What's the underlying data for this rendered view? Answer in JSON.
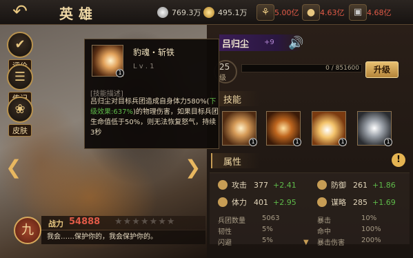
{
  "header": {
    "back_icon": "back-arrow-icon",
    "title": "英雄",
    "resources": [
      {
        "icon": "silver-coin-icon",
        "value": "769.3万",
        "color": "#d8d2c4"
      },
      {
        "icon": "gold-coin-icon",
        "value": "495.1万",
        "color": "#d8d2c4"
      },
      {
        "icon": "wheat-icon",
        "value": "5.00亿",
        "color": "#e05a47"
      },
      {
        "icon": "food-sack-icon",
        "value": "4.63亿",
        "color": "#e05a47"
      },
      {
        "icon": "iron-icon",
        "value": "4.68亿",
        "color": "#e05a47"
      }
    ]
  },
  "side_menu": [
    {
      "label": "评价",
      "icon": "review-icon"
    },
    {
      "label": "传记",
      "icon": "biography-icon"
    },
    {
      "label": "皮肤",
      "icon": "skin-icon"
    }
  ],
  "tooltip": {
    "skill_name": "豹魂・斩铁",
    "level": "L v . 1",
    "badge": "1",
    "section_label": "[技能描述]",
    "desc_part1": "吕归尘对目标兵团造成自身体力580%(",
    "desc_green": "下级效果:637%",
    "desc_part2": ")的物理伤害，如果目标兵团生命值低于50%，则无法恢复怒气，持续3秒"
  },
  "hero": {
    "name": "吕归尘",
    "plus": "+9",
    "level": "25",
    "level_suffix": "级",
    "exp": "0 / 851600",
    "upgrade_label": "升级"
  },
  "skills": {
    "title": "技能",
    "slots": [
      {
        "badge": "1"
      },
      {
        "badge": "1"
      },
      {
        "badge": "1"
      },
      {
        "badge": "1"
      }
    ]
  },
  "attributes": {
    "title": "属性",
    "main": [
      {
        "name": "攻击",
        "value": "377",
        "bonus": "+2.41"
      },
      {
        "name": "防御",
        "value": "261",
        "bonus": "+1.86"
      },
      {
        "name": "体力",
        "value": "401",
        "bonus": "+2.95"
      },
      {
        "name": "谋略",
        "value": "285",
        "bonus": "+1.69"
      }
    ],
    "secondary": [
      {
        "name": "兵团数量",
        "value": "5063"
      },
      {
        "name": "暴击",
        "value": "10%"
      },
      {
        "name": "韧性",
        "value": "5%"
      },
      {
        "name": "命中",
        "value": "100%"
      },
      {
        "name": "闪避",
        "value": "5%"
      },
      {
        "name": "暴击伤害",
        "value": "200%"
      }
    ]
  },
  "power": {
    "label": "战力",
    "value": "54888",
    "stars": "★★★★★★★",
    "star_count": 0,
    "faction_glyph": "九"
  },
  "speech": "我会……保护你的，我会保护你的。"
}
